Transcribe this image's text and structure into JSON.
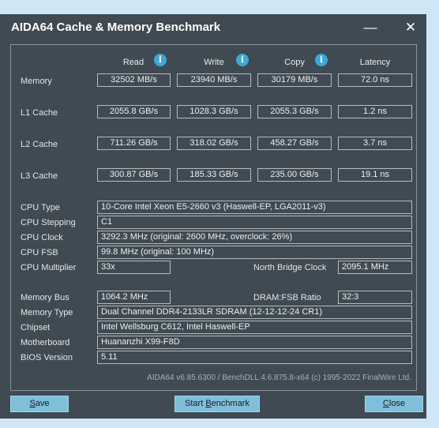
{
  "window": {
    "title": "AIDA64 Cache & Memory Benchmark"
  },
  "headers": {
    "read": "Read",
    "write": "Write",
    "copy": "Copy",
    "latency": "Latency"
  },
  "rows": [
    {
      "label": "Memory",
      "read": "32502 MB/s",
      "write": "23940 MB/s",
      "copy": "30179 MB/s",
      "latency": "72.0 ns"
    },
    {
      "label": "L1 Cache",
      "read": "2055.8 GB/s",
      "write": "1028.3 GB/s",
      "copy": "2055.3 GB/s",
      "latency": "1.2 ns"
    },
    {
      "label": "L2 Cache",
      "read": "711.26 GB/s",
      "write": "318.02 GB/s",
      "copy": "458.27 GB/s",
      "latency": "3.7 ns"
    },
    {
      "label": "L3 Cache",
      "read": "300.87 GB/s",
      "write": "185.33 GB/s",
      "copy": "235.00 GB/s",
      "latency": "19.1 ns"
    }
  ],
  "cpu": {
    "type_label": "CPU Type",
    "type": "10-Core Intel Xeon E5-2660 v3  (Haswell-EP, LGA2011-v3)",
    "stepping_label": "CPU Stepping",
    "stepping": "C1",
    "clock_label": "CPU Clock",
    "clock": "3292.3 MHz  (original: 2600 MHz, overclock: 26%)",
    "fsb_label": "CPU FSB",
    "fsb": "99.8 MHz  (original: 100 MHz)",
    "multiplier_label": "CPU Multiplier",
    "multiplier": "33x",
    "nb_clock_label": "North Bridge Clock",
    "nb_clock": "2095.1 MHz"
  },
  "system": {
    "memory_bus_label": "Memory Bus",
    "memory_bus": "1064.2 MHz",
    "dram_fsb_label": "DRAM:FSB Ratio",
    "dram_fsb": "32:3",
    "memory_type_label": "Memory Type",
    "memory_type": "Dual Channel DDR4-2133LR SDRAM  (12-12-12-24 CR1)",
    "chipset_label": "Chipset",
    "chipset": "Intel Wellsburg C612, Intel Haswell-EP",
    "motherboard_label": "Motherboard",
    "motherboard": "Huananzhi X99-F8D",
    "bios_label": "BIOS Version",
    "bios": "5.11"
  },
  "footer": "AIDA64 v6.85.6300 / BenchDLL 4.6.875.8-x64  (c) 1995-2022 FinalWire Ltd.",
  "buttons": {
    "save_first": "S",
    "save_rest": "ave",
    "start_pre": "Start ",
    "start_u": "B",
    "start_post": "enchmark",
    "close_first": "C",
    "close_rest": "lose"
  },
  "icons": {
    "minimize": "minimize-icon",
    "close": "close-icon",
    "info": "info-icon"
  }
}
